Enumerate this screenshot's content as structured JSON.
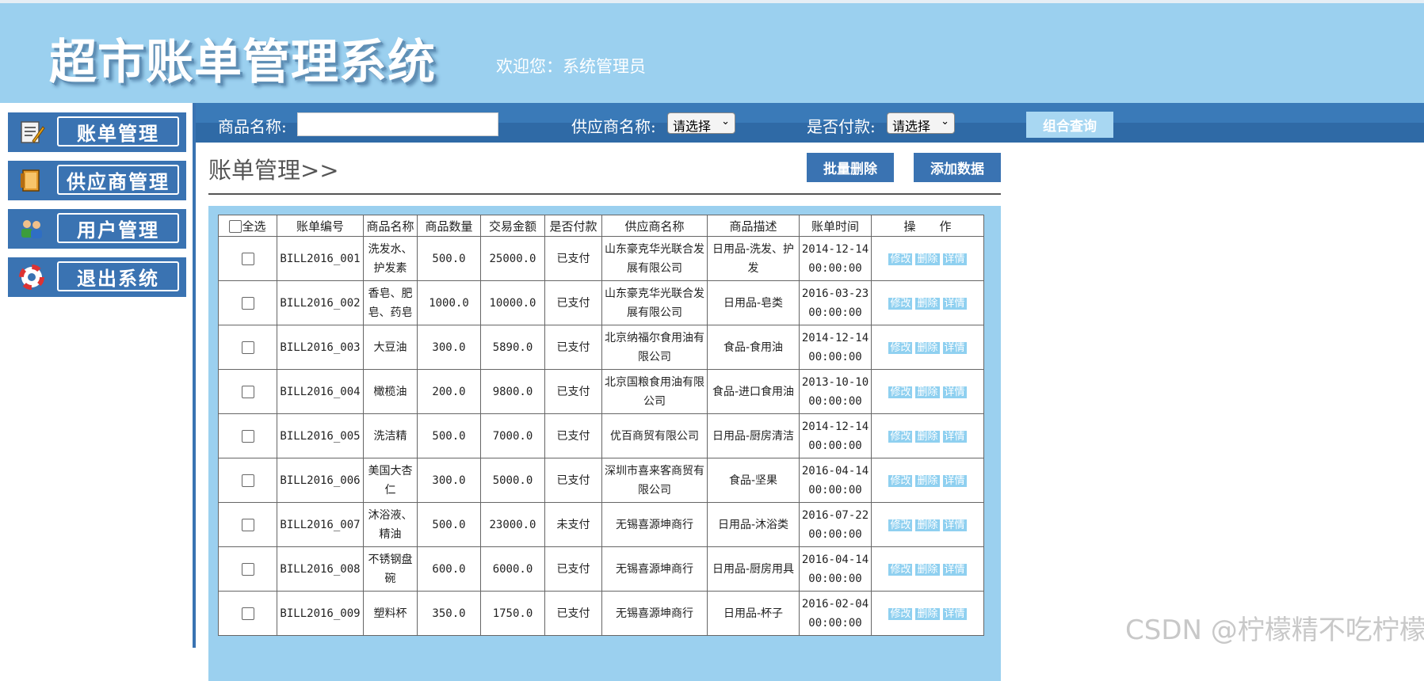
{
  "header": {
    "title": "超市账单管理系统",
    "welcome": "欢迎您：系统管理员"
  },
  "sidebar": {
    "items": [
      {
        "label": "账单管理"
      },
      {
        "label": "供应商管理"
      },
      {
        "label": "用户管理"
      },
      {
        "label": "退出系统"
      }
    ]
  },
  "search": {
    "product_label": "商品名称:",
    "product_value": "",
    "supplier_label": "供应商名称:",
    "supplier_selected": "请选择",
    "paid_label": "是否付款:",
    "paid_selected": "请选择",
    "query_button": "组合查询"
  },
  "main": {
    "title": "账单管理>>",
    "batch_delete": "批量删除",
    "add_data": "添加数据"
  },
  "table": {
    "headers": [
      "全选",
      "账单编号",
      "商品名称",
      "商品数量",
      "交易金额",
      "是否付款",
      "供应商名称",
      "商品描述",
      "账单时间",
      "操　　作"
    ],
    "actions": [
      "修改",
      "删除",
      "详情"
    ],
    "rows": [
      {
        "id": "BILL2016_001",
        "name": "洗发水、护发素",
        "qty": "500.0",
        "amount": "25000.0",
        "paid": "已支付",
        "supplier": "山东豪克华光联合发展有限公司",
        "desc": "日用品-洗发、护发",
        "time": "2014-12-14 00:00:00"
      },
      {
        "id": "BILL2016_002",
        "name": "香皂、肥皂、药皂",
        "qty": "1000.0",
        "amount": "10000.0",
        "paid": "已支付",
        "supplier": "山东豪克华光联合发展有限公司",
        "desc": "日用品-皂类",
        "time": "2016-03-23 00:00:00"
      },
      {
        "id": "BILL2016_003",
        "name": "大豆油",
        "qty": "300.0",
        "amount": "5890.0",
        "paid": "已支付",
        "supplier": "北京纳福尔食用油有限公司",
        "desc": "食品-食用油",
        "time": "2014-12-14 00:00:00"
      },
      {
        "id": "BILL2016_004",
        "name": "橄榄油",
        "qty": "200.0",
        "amount": "9800.0",
        "paid": "已支付",
        "supplier": "北京国粮食用油有限公司",
        "desc": "食品-进口食用油",
        "time": "2013-10-10 00:00:00"
      },
      {
        "id": "BILL2016_005",
        "name": "洗洁精",
        "qty": "500.0",
        "amount": "7000.0",
        "paid": "已支付",
        "supplier": "优百商贸有限公司",
        "desc": "日用品-厨房清洁",
        "time": "2014-12-14 00:00:00"
      },
      {
        "id": "BILL2016_006",
        "name": "美国大杏仁",
        "qty": "300.0",
        "amount": "5000.0",
        "paid": "已支付",
        "supplier": "深圳市喜来客商贸有限公司",
        "desc": "食品-坚果",
        "time": "2016-04-14 00:00:00"
      },
      {
        "id": "BILL2016_007",
        "name": "沐浴液、精油",
        "qty": "500.0",
        "amount": "23000.0",
        "paid": "未支付",
        "supplier": "无锡喜源坤商行",
        "desc": "日用品-沐浴类",
        "time": "2016-07-22 00:00:00"
      },
      {
        "id": "BILL2016_008",
        "name": "不锈钢盘碗",
        "qty": "600.0",
        "amount": "6000.0",
        "paid": "已支付",
        "supplier": "无锡喜源坤商行",
        "desc": "日用品-厨房用具",
        "time": "2016-04-14 00:00:00"
      },
      {
        "id": "BILL2016_009",
        "name": "塑料杯",
        "qty": "350.0",
        "amount": "1750.0",
        "paid": "已支付",
        "supplier": "无锡喜源坤商行",
        "desc": "日用品-杯子",
        "time": "2016-02-04 00:00:00"
      }
    ]
  },
  "watermark": "CSDN @柠檬精不吃柠檬"
}
